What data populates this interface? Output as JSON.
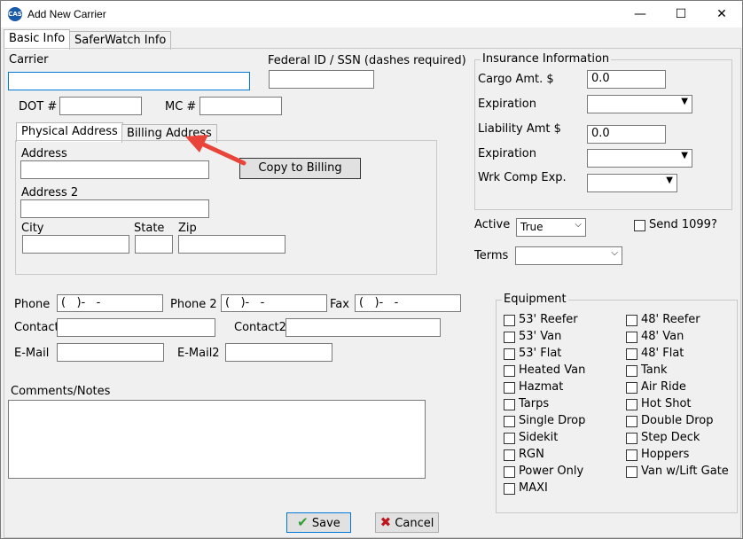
{
  "window": {
    "title": "Add New Carrier",
    "icon_text": "CAS"
  },
  "controls": {
    "minimize": "—",
    "maximize": "☐",
    "close": "✕"
  },
  "tabs": [
    {
      "label": "Basic Info"
    },
    {
      "label": "SaferWatch Info"
    }
  ],
  "carrier": {
    "label": "Carrier",
    "value": ""
  },
  "federal": {
    "label": "Federal ID / SSN (dashes required)",
    "value": ""
  },
  "dot": {
    "label": "DOT #",
    "value": ""
  },
  "mc": {
    "label": "MC #",
    "value": ""
  },
  "address_tabs": [
    {
      "label": "Physical Address"
    },
    {
      "label": "Billing Address"
    }
  ],
  "address": {
    "address_label": "Address",
    "address_value": "",
    "address2_label": "Address 2",
    "address2_value": "",
    "city_label": "City",
    "city_value": "",
    "state_label": "State",
    "state_value": "",
    "zip_label": "Zip",
    "zip_value": "",
    "copy_button": "Copy to Billing"
  },
  "insurance": {
    "title": "Insurance Information",
    "cargo_label": "Cargo Amt.  $",
    "cargo_value": "0.0",
    "expiration_label": "Expiration",
    "liability_label": "Liability Amt $",
    "liability_value": "0.0",
    "expiration2_label": "Expiration",
    "wrk_label": "Wrk Comp Exp."
  },
  "active": {
    "label": "Active",
    "value": "True"
  },
  "send1099": {
    "label": "Send 1099?",
    "checked": false
  },
  "terms": {
    "label": "Terms",
    "value": ""
  },
  "contact": {
    "phone_label": "Phone",
    "phone_value": "(   )-   -",
    "phone2_label": "Phone 2",
    "phone2_value": "(   )-   -",
    "fax_label": "Fax",
    "fax_value": "(   )-   -",
    "contact_label": "Contact",
    "contact_value": "",
    "contact2_label": "Contact2",
    "contact2_value": "",
    "email_label": "E-Mail",
    "email_value": "",
    "email2_label": "E-Mail2",
    "email2_value": ""
  },
  "comments": {
    "label": "Comments/Notes",
    "value": ""
  },
  "equipment": {
    "title": "Equipment",
    "left": [
      "53' Reefer",
      "53' Van",
      "53' Flat",
      "Heated Van",
      "Hazmat",
      "Tarps",
      "Single Drop",
      "Sidekit",
      "RGN",
      "Power Only",
      "MAXI"
    ],
    "right": [
      "48' Reefer",
      "48' Van",
      "48' Flat",
      "Tank",
      "Air Ride",
      "Hot Shot",
      "Double Drop",
      "Step Deck",
      "Hoppers",
      "Van w/Lift Gate"
    ]
  },
  "buttons": {
    "save": "Save",
    "cancel": "Cancel"
  },
  "colors": {
    "save_check": "#2e9e2e",
    "cancel_x": "#c0141c",
    "arrow": "#e8443a",
    "focus": "#0078d7"
  }
}
